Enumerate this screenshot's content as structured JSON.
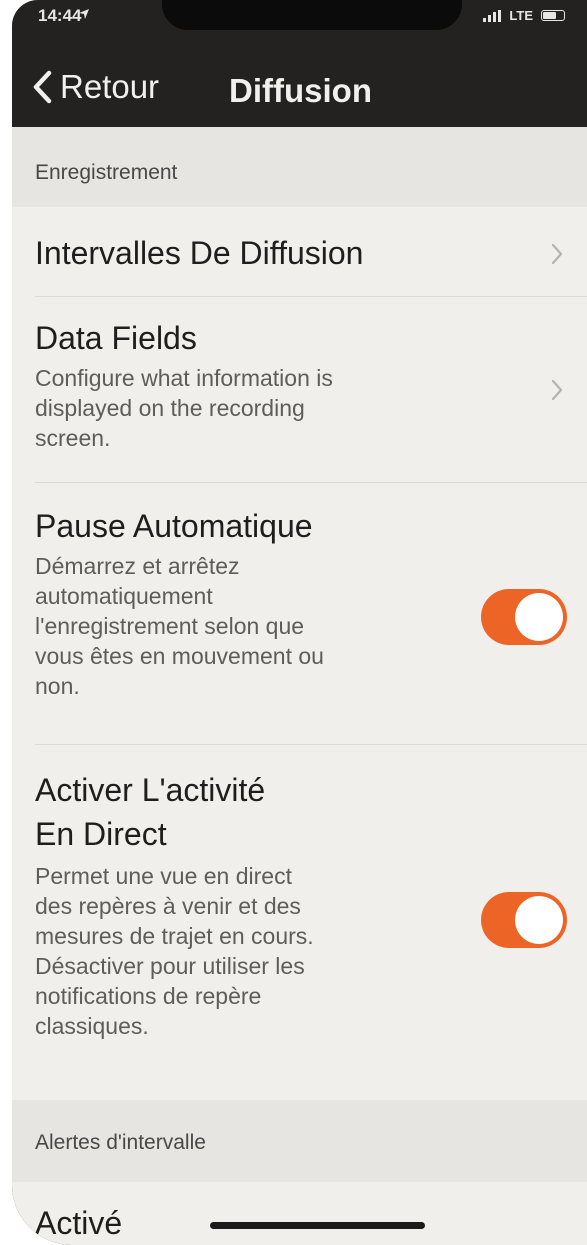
{
  "status_bar": {
    "time": "14:44",
    "network": "LTE"
  },
  "nav": {
    "back_label": "Retour",
    "title": "Diffusion"
  },
  "sections": {
    "recording": {
      "header": "Enregistrement",
      "rows": {
        "intervals": {
          "title": "Intervalles De Diffusion"
        },
        "data_fields": {
          "title": "Data Fields",
          "subtitle_lines": [
            "Configure what information is",
            "displayed on the recording",
            "screen."
          ]
        },
        "auto_pause": {
          "title": "Pause Automatique",
          "subtitle_lines": [
            "Démarrez et arrêtez",
            "automatiquement",
            "l'enregistrement selon que",
            "vous êtes en mouvement ou",
            "non."
          ],
          "enabled": true
        },
        "live_activity": {
          "title_lines": [
            "Activer L'activité",
            "En Direct"
          ],
          "subtitle_lines": [
            "Permet une vue en direct",
            "des repères à venir et des",
            "mesures de trajet en cours.",
            "Désactiver pour utiliser les",
            "notifications de repère",
            "classiques."
          ],
          "enabled": true
        }
      }
    },
    "interval_alerts": {
      "header": "Alertes d'intervalle",
      "rows": {
        "enabled_row": {
          "title": "Activé"
        }
      }
    }
  },
  "colors": {
    "accent": "#ec6526",
    "header_bg": "#232221",
    "background": "#f1efec"
  }
}
